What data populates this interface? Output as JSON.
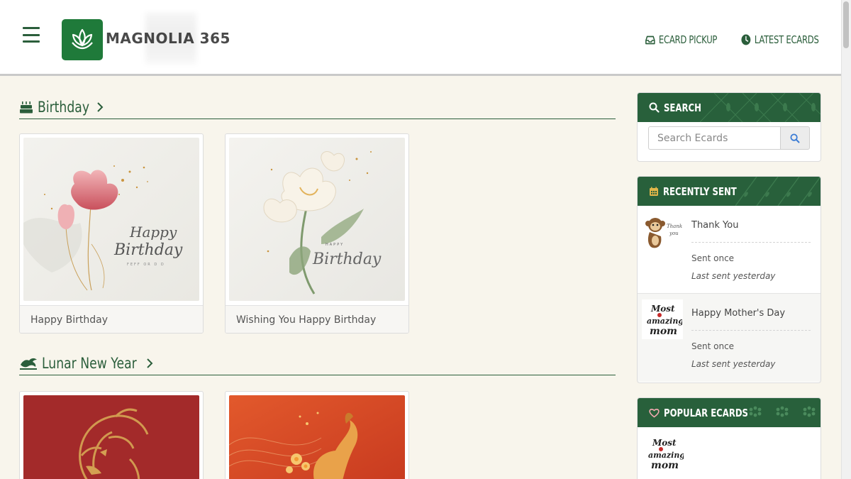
{
  "brand": {
    "name": "MAGNOLIA 365",
    "green": "#28603b",
    "logo_icon": "lotus-icon"
  },
  "nav": {
    "pickup_label": "ECARD PICKUP",
    "latest_label": "LATEST ECARDS"
  },
  "sections": [
    {
      "title": "Birthday",
      "icon": "cake-icon",
      "cards": [
        {
          "caption": "Happy Birthday"
        },
        {
          "caption": "Wishing You Happy Birthday"
        }
      ]
    },
    {
      "title": "Lunar New Year",
      "icon": "dragon-icon",
      "cards": [
        {
          "caption": ""
        },
        {
          "caption": ""
        }
      ]
    }
  ],
  "sidebar": {
    "search": {
      "heading": "SEARCH",
      "placeholder": "Search Ecards"
    },
    "recent": {
      "heading": "RECENTLY SENT",
      "items": [
        {
          "title": "Thank You",
          "sent": "Sent once",
          "last": "Last sent yesterday"
        },
        {
          "title": "Happy Mother's Day",
          "sent": "Sent once",
          "last": "Last sent yesterday"
        }
      ]
    },
    "popular": {
      "heading": "POPULAR ECARDS"
    }
  }
}
